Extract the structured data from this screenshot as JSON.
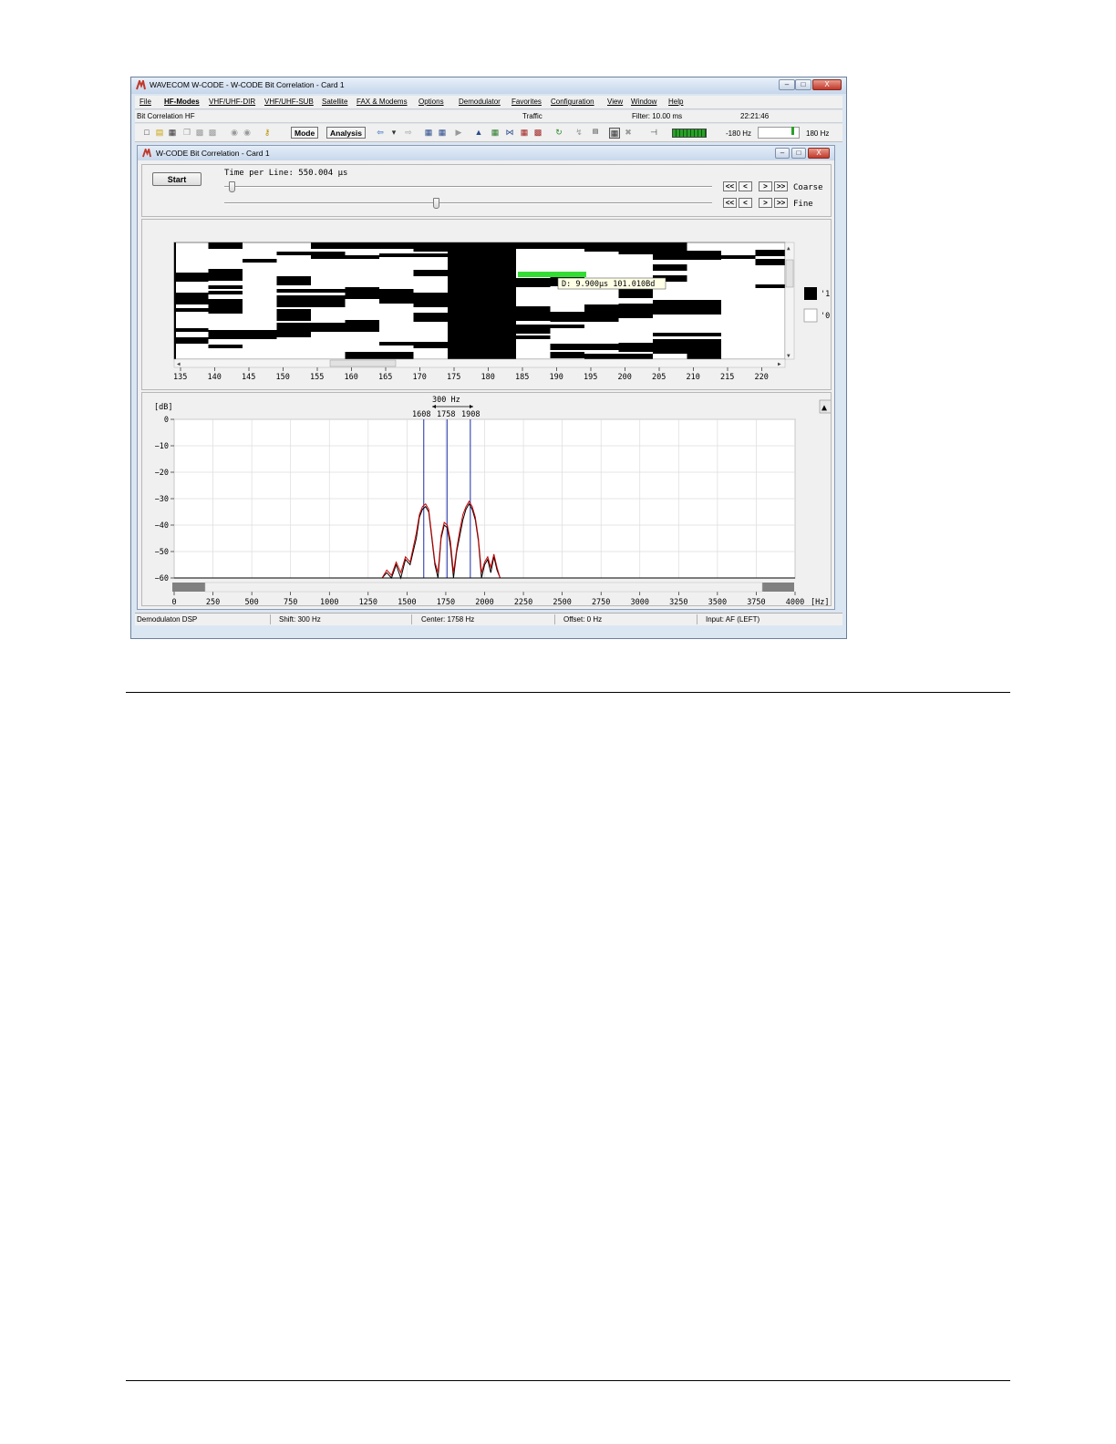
{
  "window": {
    "title": "WAVECOM W-CODE - W-CODE Bit Correlation  - Card 1",
    "controls": [
      "–",
      "□",
      "X"
    ]
  },
  "menu": [
    "File",
    "HF-Modes",
    "VHF/UHF-DIR",
    "VHF/UHF-SUB",
    "Satellite",
    "FAX & Modems",
    "Options",
    "Demodulator",
    "Favorites",
    "Configuration",
    "View",
    "Window",
    "Help"
  ],
  "infobar": {
    "mode": "Bit Correlation HF",
    "traffic": "Traffic",
    "filter": "Filter: 10.00 ms",
    "time": "22:21:46"
  },
  "toolbar": {
    "mode_label": "Mode",
    "analysis_label": "Analysis",
    "freq_left": "-180 Hz",
    "freq_right": "180 Hz"
  },
  "child": {
    "title": "W-CODE Bit Correlation  - Card 1"
  },
  "controls": {
    "start_label": "Start",
    "time_per_line": "Time per Line: 550.004 µs",
    "coarse_label": "Coarse",
    "fine_label": "Fine",
    "nav_buttons": [
      "<<",
      "<",
      ">",
      ">>"
    ]
  },
  "correlation": {
    "x_ticks": [
      "135",
      "140",
      "145",
      "150",
      "155",
      "160",
      "165",
      "170",
      "175",
      "180",
      "185",
      "190",
      "195",
      "200",
      "205",
      "210",
      "215",
      "220"
    ],
    "tooltip": "D: 9.900µs 101.010Bd",
    "legend": [
      "'1'",
      "'0'"
    ]
  },
  "chart_data": {
    "type": "line",
    "title": "",
    "xlabel": "[Hz]",
    "ylabel": "[dB]",
    "xlim": [
      0,
      4000
    ],
    "ylim": [
      -60,
      0
    ],
    "x_ticks": [
      0,
      250,
      500,
      750,
      1000,
      1250,
      1500,
      1750,
      2000,
      2250,
      2500,
      2750,
      3000,
      3250,
      3500,
      3750,
      4000
    ],
    "y_ticks": [
      0,
      -10,
      -20,
      -30,
      -40,
      -50,
      -60
    ],
    "grid": true,
    "markers": [
      1608,
      1758,
      1908
    ],
    "marker_labels": [
      "1608",
      "1758",
      "1908"
    ],
    "shift_label": "300 Hz",
    "series": [
      {
        "color": "#000000",
        "x": [
          1340,
          1370,
          1400,
          1430,
          1460,
          1490,
          1520,
          1560,
          1580,
          1600,
          1620,
          1640,
          1660,
          1680,
          1700,
          1720,
          1740,
          1760,
          1780,
          1800,
          1820,
          1840,
          1860,
          1880,
          1900,
          1920,
          1940,
          1960,
          1980,
          2000,
          2020,
          2040,
          2060,
          2080,
          2100
        ],
        "y": [
          -60,
          -58,
          -60,
          -55,
          -60,
          -53,
          -55,
          -45,
          -37,
          -34,
          -33,
          -35,
          -45,
          -55,
          -60,
          -45,
          -40,
          -41,
          -48,
          -60,
          -50,
          -44,
          -38,
          -34,
          -32,
          -34,
          -38,
          -46,
          -60,
          -55,
          -53,
          -58,
          -52,
          -57,
          -60
        ]
      },
      {
        "color": "#cc0000",
        "x": [
          1340,
          1370,
          1400,
          1430,
          1460,
          1490,
          1520,
          1560,
          1580,
          1600,
          1620,
          1640,
          1660,
          1680,
          1700,
          1720,
          1740,
          1760,
          1780,
          1800,
          1820,
          1840,
          1860,
          1880,
          1900,
          1920,
          1940,
          1960,
          1980,
          2000,
          2020,
          2040,
          2060,
          2080,
          2100
        ],
        "y": [
          -60,
          -57,
          -59,
          -54,
          -58,
          -52,
          -54,
          -43,
          -36,
          -33,
          -32,
          -34,
          -44,
          -54,
          -58,
          -44,
          -39,
          -40,
          -46,
          -58,
          -49,
          -42,
          -36,
          -33,
          -31,
          -33,
          -37,
          -45,
          -58,
          -54,
          -52,
          -56,
          -51,
          -56,
          -60
        ]
      }
    ]
  },
  "statusbar": {
    "demod": "Demodulaton DSP",
    "shift": "Shift: 300 Hz",
    "center": "Center: 1758 Hz",
    "offset": "Offset: 0 Hz",
    "input": "Input: AF (LEFT)"
  }
}
